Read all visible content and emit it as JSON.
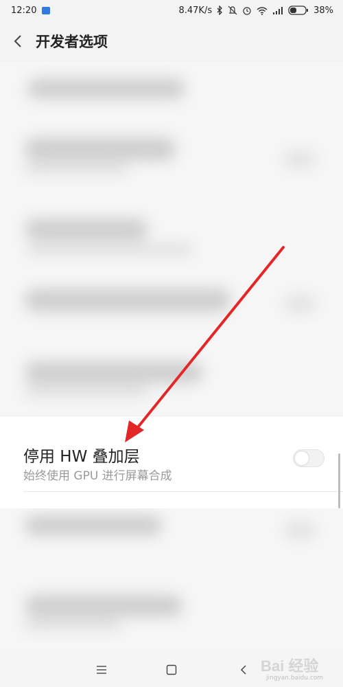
{
  "status_bar": {
    "time": "12:20",
    "net_speed": "8.47K/s",
    "battery": "38%",
    "icons": [
      "network-badge-icon",
      "bluetooth-icon",
      "mute-icon",
      "alarm-icon",
      "wifi-icon",
      "signal-icon",
      "battery-icon"
    ]
  },
  "header": {
    "back_icon": "chevron-left-icon",
    "title": "开发者选项"
  },
  "setting_item": {
    "title": "停用 HW 叠加层",
    "subtitle": "始终使用 GPU 进行屏幕合成",
    "toggle_on": false
  },
  "nav_bar": {
    "icons": [
      "menu-icon",
      "home-icon",
      "back-icon"
    ]
  },
  "watermark": {
    "brand": "Bai 经验",
    "site": "jingyan.baidu.com"
  },
  "colors": {
    "arrow": "#e32626",
    "background": "#f4f4f4",
    "text_primary": "#222222",
    "text_secondary": "#9a9a9a",
    "net_badge": "#2f7be0"
  }
}
